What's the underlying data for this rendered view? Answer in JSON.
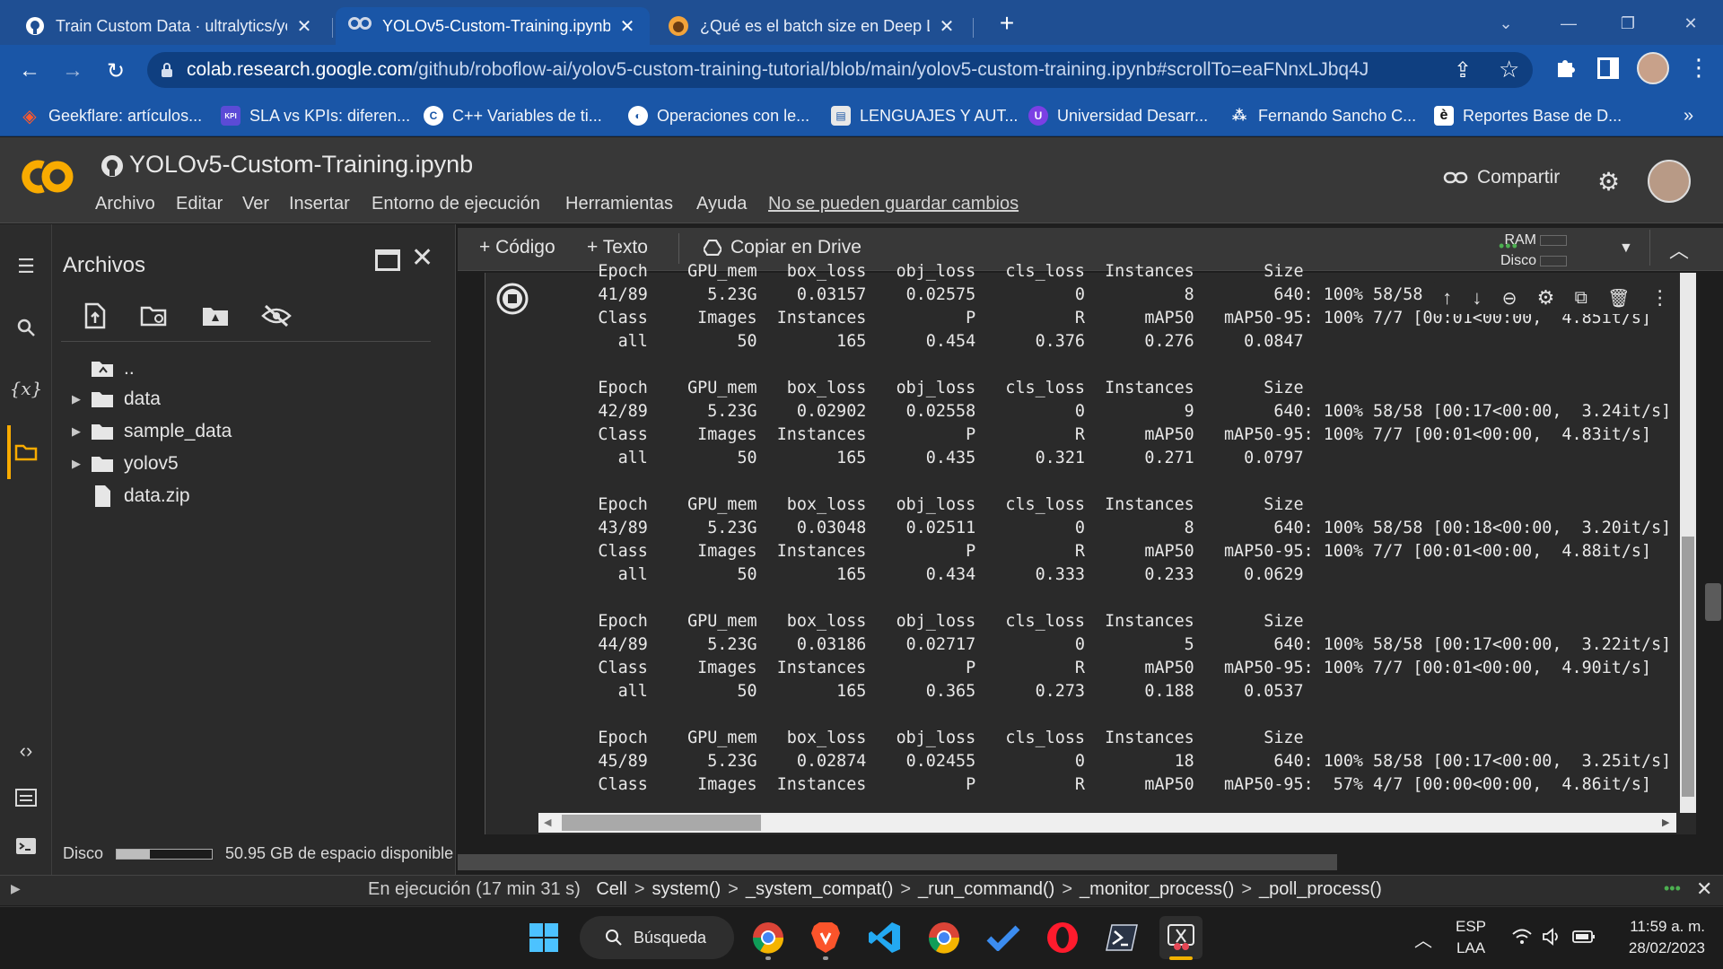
{
  "browser": {
    "tabs": [
      {
        "title": "Train Custom Data · ultralytics/yo",
        "icon": "github-icon",
        "active": false
      },
      {
        "title": "YOLOv5-Custom-Training.ipynb -",
        "icon": "colab-icon",
        "active": true
      },
      {
        "title": "¿Qué es el batch size en Deep Le",
        "icon": "site-icon",
        "active": false
      }
    ],
    "url_domain": "colab.research.google.com",
    "url_path": "/github/roboflow-ai/yolov5-custom-training-tutorial/blob/main/yolov5-custom-training.ipynb#scrollTo=eaFNnxLJbq4J",
    "bookmarks": [
      "Geekflare: artículos...",
      "SLA vs KPIs: diferen...",
      "C++ Variables de ti...",
      "Operaciones con le...",
      "LENGUAJES Y AUT...",
      "Universidad Desarr...",
      "Fernando Sancho C...",
      "Reportes Base de D..."
    ],
    "bookmarks_more": "»"
  },
  "colab": {
    "logo_text": "CO",
    "notebook_title": "YOLOv5-Custom-Training.ipynb",
    "menu": [
      "Archivo",
      "Editar",
      "Ver",
      "Insertar",
      "Entorno de ejecución",
      "Herramientas",
      "Ayuda"
    ],
    "unsaved_notice": "No se pueden guardar cambios",
    "share_label": "Compartir",
    "toolbar": {
      "code_label": "+ Código",
      "text_label": "+ Texto",
      "drive_label": "Copiar en Drive",
      "ram_label": "RAM",
      "disk_label": "Disco"
    }
  },
  "files_panel": {
    "title": "Archivos",
    "entries": [
      {
        "name": "..",
        "type": "parent"
      },
      {
        "name": "data",
        "type": "folder"
      },
      {
        "name": "sample_data",
        "type": "folder"
      },
      {
        "name": "yolov5",
        "type": "folder"
      },
      {
        "name": "data.zip",
        "type": "file"
      }
    ],
    "disk_label": "Disco",
    "disk_fraction": 0.35,
    "disk_free": "50.95 GB de espacio disponible"
  },
  "output_lines": [
    "Epoch    GPU_mem   box_loss   obj_loss   cls_loss  Instances       Size",
    "41/89      5.23G    0.03157    0.02575          0          8        640: 100% 58/58 [00:17<00:00,  3.24it/s]",
    "Class     Images  Instances          P          R      mAP50   mAP50-95: 100% 7/7 [00:01<00:00,  4.85it/s]",
    "  all         50        165      0.454      0.376      0.276     0.0847",
    "",
    "Epoch    GPU_mem   box_loss   obj_loss   cls_loss  Instances       Size",
    "42/89      5.23G    0.02902    0.02558          0          9        640: 100% 58/58 [00:17<00:00,  3.24it/s]",
    "Class     Images  Instances          P          R      mAP50   mAP50-95: 100% 7/7 [00:01<00:00,  4.83it/s]",
    "  all         50        165      0.435      0.321      0.271     0.0797",
    "",
    "Epoch    GPU_mem   box_loss   obj_loss   cls_loss  Instances       Size",
    "43/89      5.23G    0.03048    0.02511          0          8        640: 100% 58/58 [00:18<00:00,  3.20it/s]",
    "Class     Images  Instances          P          R      mAP50   mAP50-95: 100% 7/7 [00:01<00:00,  4.88it/s]",
    "  all         50        165      0.434      0.333      0.233     0.0629",
    "",
    "Epoch    GPU_mem   box_loss   obj_loss   cls_loss  Instances       Size",
    "44/89      5.23G    0.03186    0.02717          0          5        640: 100% 58/58 [00:17<00:00,  3.22it/s]",
    "Class     Images  Instances          P          R      mAP50   mAP50-95: 100% 7/7 [00:01<00:00,  4.90it/s]",
    "  all         50        165      0.365      0.273      0.188     0.0537",
    "",
    "Epoch    GPU_mem   box_loss   obj_loss   cls_loss  Instances       Size",
    "45/89      5.23G    0.02874    0.02455          0         18        640: 100% 58/58 [00:17<00:00,  3.25it/s]",
    "Class     Images  Instances          P          R      mAP50   mAP50-95:  57% 4/7 [00:00<00:00,  4.86it/s]"
  ],
  "status": {
    "running": "En ejecución (17 min 31 s)",
    "crumbs": [
      "Cell",
      "system()",
      "_system_compat()",
      "_run_command()",
      "_monitor_process()",
      "_poll_process()"
    ],
    "sep": ">"
  },
  "taskbar": {
    "search_label": "Búsqueda",
    "lang": "ESP",
    "layout": "LAA",
    "time": "11:59 a. m.",
    "date": "28/02/2023"
  },
  "colors": {
    "chrome_blue": "#1a56a7",
    "colab_orange": "#f9ab00",
    "colab_dark": "#383838"
  }
}
